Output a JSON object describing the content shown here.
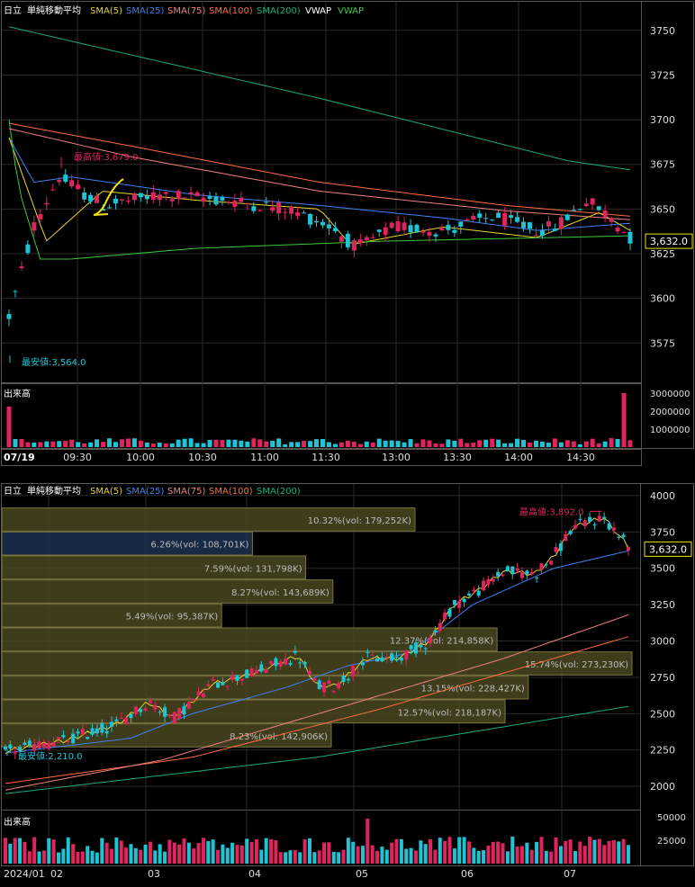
{
  "colors": {
    "up": "#e0245e",
    "down": "#1fc4d4",
    "sma5": "#e6d52a",
    "sma25": "#3d82f0",
    "sma75": "#f08080",
    "sma100": "#ff6a3d",
    "sma200": "#1eaa7a",
    "vwap1": "#ffffff",
    "vwap2": "#3cc83c",
    "grid": "#2a2a2a",
    "panel_border": "#555555",
    "vp_fill": "#4a4620",
    "vp_fill_hi": "#1c3050",
    "vp_edge": "#7a7440",
    "last_box": "#f4e000",
    "high_label": "#e0245e",
    "low_label": "#1fc4d4",
    "marker": "#f4e000"
  },
  "top": {
    "legend": {
      "name": "日立",
      "title": "単純移動平均",
      "sma5": "SMA(5)",
      "sma25": "SMA(25)",
      "sma75": "SMA(75)",
      "sma100": "SMA(100)",
      "sma200": "SMA(200)",
      "vwap1": "VWAP",
      "vwap2": "VWAP"
    },
    "high_label": "最高値:3,679.0",
    "low_label": "最安値:3,564.0",
    "last_price": "3,632.0",
    "volume_title": "出来高",
    "date_label": "07/19"
  },
  "bottom": {
    "legend": {
      "name": "日立",
      "title": "単純移動平均",
      "sma5": "SMA(5)",
      "sma25": "SMA(25)",
      "sma75": "SMA(75)",
      "sma100": "SMA(100)",
      "sma200": "SMA(200)"
    },
    "high_label": "最高値:3,892.0",
    "low_label": "最安値:2,210.0",
    "last_price": "3,632.0",
    "volume_title": "出来高"
  },
  "chart_data": [
    {
      "type": "candlestick",
      "title": "日立 単純移動平均 (intraday 07/19)",
      "series_names": [
        "SMA(5)",
        "SMA(25)",
        "SMA(75)",
        "SMA(100)",
        "SMA(200)",
        "VWAP",
        "VWAP"
      ],
      "x_ticks": [
        "09:30",
        "10:00",
        "10:30",
        "11:00",
        "11:30",
        "13:00",
        "13:30",
        "14:00",
        "14:30"
      ],
      "y_ticks": [
        3575,
        3600,
        3625,
        3650,
        3675,
        3700,
        3725,
        3750
      ],
      "ylim": [
        3553,
        3766
      ],
      "volume_ticks": [
        1000000,
        2000000,
        3000000
      ],
      "volume_tick_labels": [
        "1000000",
        "2000000",
        "3000000"
      ],
      "high": 3679.0,
      "low": 3564.0,
      "last": 3632.0
    },
    {
      "type": "candlestick",
      "title": "日立 単純移動平均 (daily 2024)",
      "series_names": [
        "SMA(5)",
        "SMA(25)",
        "SMA(75)",
        "SMA(100)",
        "SMA(200)"
      ],
      "x_ticks": [
        "2024/01",
        "02",
        "03",
        "04",
        "05",
        "06",
        "07"
      ],
      "y_ticks": [
        2000,
        2250,
        2500,
        2750,
        3000,
        3250,
        3500,
        3750,
        4000
      ],
      "ylim": [
        1840,
        4080
      ],
      "volume_ticks": [
        25000,
        50000
      ],
      "volume_tick_labels": [
        "25000",
        "50000"
      ],
      "high": 3892.0,
      "low": 2210.0,
      "last": 3632.0,
      "volume_profile": [
        {
          "pct": "10.32%",
          "vol": "179,252K",
          "label": "10.32%(vol: 179,252K)",
          "low": 3750,
          "high": 3915
        },
        {
          "pct": "6.26%",
          "vol": "108,701K",
          "label": "6.26%(vol: 108,701K)",
          "low": 3585,
          "high": 3750
        },
        {
          "pct": "7.59%",
          "vol": "131,798K",
          "label": "7.59%(vol: 131,798K)",
          "low": 3420,
          "high": 3585
        },
        {
          "pct": "8.27%",
          "vol": "143,689K",
          "label": "8.27%(vol: 143,689K)",
          "low": 3255,
          "high": 3420
        },
        {
          "pct": "5.49%",
          "vol": "95,387K",
          "label": "5.49%(vol: 95,387K)",
          "low": 3090,
          "high": 3255
        },
        {
          "pct": "12.37%",
          "vol": "214,858K",
          "label": "12.37%(vol: 214,858K)",
          "low": 2925,
          "high": 3090
        },
        {
          "pct": "15.74%",
          "vol": "273,230K",
          "label": "15.74%(vol: 273,230K)",
          "low": 2760,
          "high": 2925
        },
        {
          "pct": "13.15%",
          "vol": "228,427K",
          "label": "13.15%(vol: 228,427K)",
          "low": 2595,
          "high": 2760
        },
        {
          "pct": "12.57%",
          "vol": "218,187K",
          "label": "12.57%(vol: 218,187K)",
          "low": 2430,
          "high": 2595
        },
        {
          "pct": "8.23%",
          "vol": "142,906K",
          "label": "8.23%(vol: 142,906K)",
          "low": 2265,
          "high": 2430
        }
      ]
    }
  ]
}
